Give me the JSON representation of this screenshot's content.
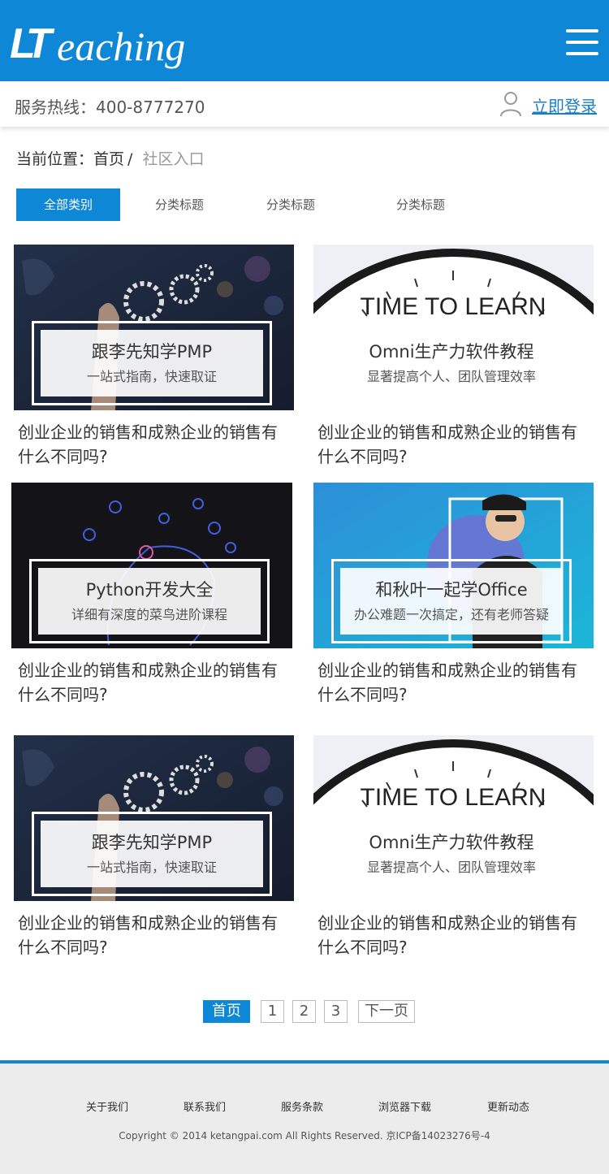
{
  "header": {
    "logo_mark": "LT",
    "logo_text": "eaching",
    "menu_icon": "hamburger-icon"
  },
  "hotline": {
    "text": "服务热线：400-8777270",
    "login_label": "立即登录",
    "user_icon": "user-icon"
  },
  "breadcrumb": {
    "prefix": "当前位置：",
    "home": "首页",
    "separator": "/",
    "current": "社区入口"
  },
  "tabs": [
    {
      "label": "全部类别",
      "active": true
    },
    {
      "label": "分类标题"
    },
    {
      "label": "分类标题"
    },
    {
      "label": "分类标题"
    }
  ],
  "cards": [
    {
      "thumb_title": "跟李先知学PMP",
      "thumb_sub": "一站式指南，快速取证",
      "caption": "创业企业的销售和成熟企业的销售有什么不同吗?"
    },
    {
      "thumb_title": "Omni生产力软件教程",
      "thumb_sub": "显著提高个人、团队管理效率",
      "caption": "创业企业的销售和成熟企业的销售有什么不同吗?"
    },
    {
      "thumb_title": "Python开发大全",
      "thumb_sub": "详细有深度的菜鸟进阶课程",
      "caption": "创业企业的销售和成熟企业的销售有什么不同吗?"
    },
    {
      "thumb_title": "和秋叶一起学Office",
      "thumb_sub": "办公难题一次搞定，还有老师答疑",
      "caption": "创业企业的销售和成熟企业的销售有什么不同吗?"
    },
    {
      "thumb_title": "跟李先知学PMP",
      "thumb_sub": "一站式指南，快速取证",
      "caption": "创业企业的销售和成熟企业的销售有什么不同吗?"
    },
    {
      "thumb_title": "Omni生产力软件教程",
      "thumb_sub": "显著提高个人、团队管理效率",
      "caption": "创业企业的销售和成熟企业的销售有什么不同吗?"
    }
  ],
  "clock_text": "TIME TO LEARN",
  "pagination": {
    "first": "首页",
    "pages": [
      "1",
      "2",
      "3"
    ],
    "next": "下一页"
  },
  "footer": {
    "links": [
      "关于我们",
      "联系我们",
      "服务条款",
      "浏览器下载",
      "更新动态"
    ],
    "copyright": "Copyright © 2014 ketangpai.com All Rights Reserved. 京ICP备14023276号-4"
  },
  "colors": {
    "brand": "#0d87d6",
    "link": "#1a7ec9",
    "footer_bg": "#ececec"
  }
}
